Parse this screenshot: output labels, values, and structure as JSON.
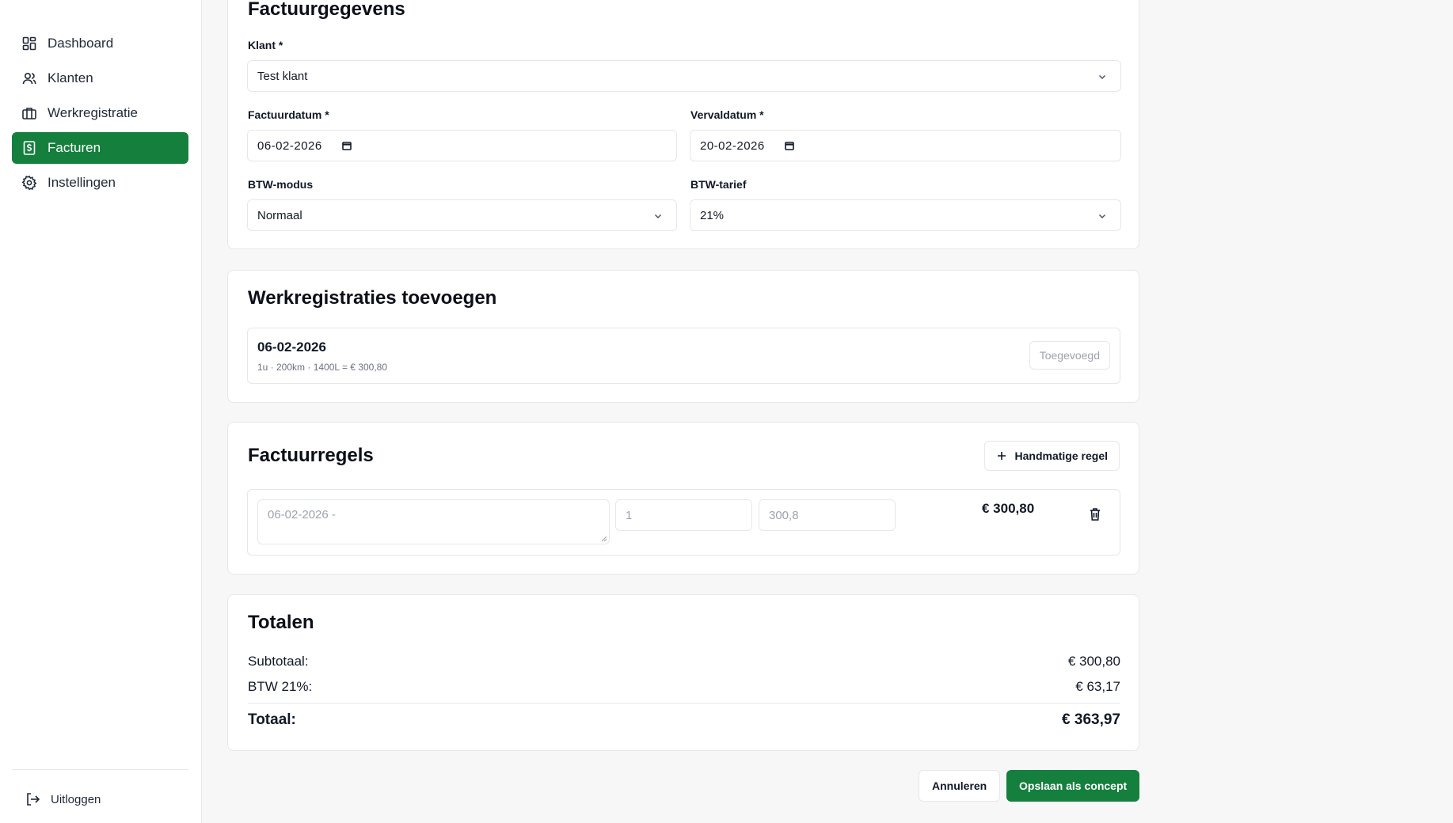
{
  "sidebar": {
    "items": [
      {
        "label": "Dashboard",
        "icon": "dashboard-grid-icon",
        "active": false
      },
      {
        "label": "Klanten",
        "icon": "users-icon",
        "active": false
      },
      {
        "label": "Werkregistratie",
        "icon": "briefcase-icon",
        "active": false
      },
      {
        "label": "Facturen",
        "icon": "invoice-dollar-icon",
        "active": true
      },
      {
        "label": "Instellingen",
        "icon": "gear-icon",
        "active": false
      }
    ],
    "logout_label": "Uitloggen"
  },
  "invoice_details": {
    "title": "Factuurgegevens",
    "client_label": "Klant *",
    "client_value": "Test klant",
    "invoice_date_label": "Factuurdatum *",
    "invoice_date_value": "06-02-2026",
    "due_date_label": "Vervaldatum *",
    "due_date_value": "20-02-2026",
    "vat_mode_label": "BTW-modus",
    "vat_mode_value": "Normaal",
    "vat_rate_label": "BTW-tarief",
    "vat_rate_value": "21%"
  },
  "work_registrations": {
    "title": "Werkregistraties toevoegen",
    "items": [
      {
        "date": "06-02-2026",
        "meta": "1u · 200km · 1400L = € 300,80",
        "status": "Toegevoegd"
      }
    ]
  },
  "invoice_lines": {
    "title": "Factuurregels",
    "add_manual_label": "Handmatige regel",
    "lines": [
      {
        "description": "06-02-2026 -",
        "quantity": "1",
        "price": "300,8",
        "total": "€ 300,80"
      }
    ]
  },
  "totals": {
    "title": "Totalen",
    "subtotal_label": "Subtotaal:",
    "subtotal_value": "€ 300,80",
    "vat_label": "BTW 21%:",
    "vat_value": "€ 63,17",
    "total_label": "Totaal:",
    "total_value": "€ 363,97"
  },
  "actions": {
    "cancel_label": "Annuleren",
    "save_label": "Opslaan als concept"
  },
  "colors": {
    "accent": "#15803d",
    "border": "#e5e7eb",
    "background": "#f7f7f8"
  }
}
